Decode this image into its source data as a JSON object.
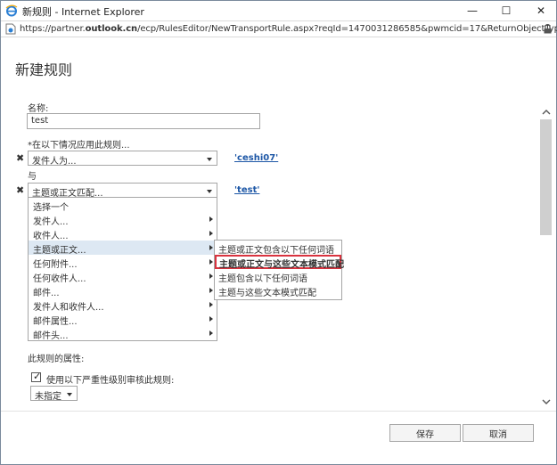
{
  "window": {
    "title": "新规则 - Internet Explorer",
    "minimize": "—",
    "maximize": "☐",
    "close": "✕"
  },
  "address": {
    "url_prefix": "https://partner.",
    "url_domain": "outlook.cn",
    "url_rest": "/ecp/RulesEditor/NewTransportRule.aspx?reqId=1470031286585&pwmcid=17&ReturnObjectType=1"
  },
  "form": {
    "heading": "新建规则",
    "name_label": "名称:",
    "name_value": "test",
    "apply_if_label": "*在以下情况应用此规则...",
    "condition1": {
      "select": "发件人为...",
      "value": "'ceshi07'"
    },
    "and_label": "与",
    "condition2": {
      "select": "主题或正文匹配...",
      "value": "'test'"
    },
    "remove_symbol": "✖",
    "properties_label": "此规则的属性:",
    "audit_label": "使用以下严重性级别审核此规则:",
    "severity_value": "未指定",
    "check_mark": "✓"
  },
  "menu": {
    "items": [
      {
        "label": "选择一个",
        "arrow": false
      },
      {
        "label": "发件人...",
        "arrow": true
      },
      {
        "label": "收件人...",
        "arrow": true
      },
      {
        "label": "主题或正文...",
        "arrow": true
      },
      {
        "label": "任何附件...",
        "arrow": true
      },
      {
        "label": "任何收件人...",
        "arrow": true
      },
      {
        "label": "邮件...",
        "arrow": true
      },
      {
        "label": "发件人和收件人...",
        "arrow": true
      },
      {
        "label": "邮件属性...",
        "arrow": true
      },
      {
        "label": "邮件头...",
        "arrow": true
      }
    ]
  },
  "submenu": {
    "items": [
      "主题或正文包含以下任何词语",
      "主题或正文与这些文本模式匹配",
      "主题包含以下任何词语",
      "主题与这些文本模式匹配"
    ]
  },
  "footer": {
    "save": "保存",
    "cancel": "取消"
  },
  "colors": {
    "link": "#1d57a6",
    "highlight_border": "#d9333f",
    "menu_active": "#dde8f3"
  }
}
